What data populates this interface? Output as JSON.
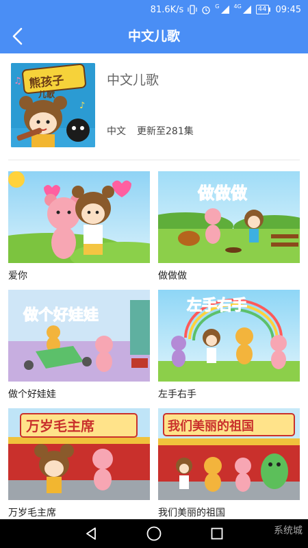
{
  "status_bar": {
    "speed": "81.6K/s",
    "network_label": "4G",
    "signal_label": "G",
    "battery": "44",
    "time": "09:45"
  },
  "header": {
    "title": "中文儿歌"
  },
  "album": {
    "name": "中文儿歌",
    "language": "中文",
    "episodes": "更新至281集",
    "cover_logo_text": "熊孩子儿歌"
  },
  "songs": [
    {
      "title": "爱你",
      "banner": ""
    },
    {
      "title": "做做做",
      "banner": "做做做"
    },
    {
      "title": "做个好娃娃",
      "banner": "做个好娃娃"
    },
    {
      "title": "左手右手",
      "banner": "左手右手"
    },
    {
      "title": "万岁毛主席",
      "banner": "万岁毛主席"
    },
    {
      "title": "我们美丽的祖国",
      "banner": "我们美丽的祖国"
    }
  ],
  "watermark": "系统城",
  "colors": {
    "primary": "#4a8ef5",
    "nav": "#000000"
  },
  "icons": {
    "back": "chevron-left-icon",
    "nav_back": "triangle-back-icon",
    "nav_home": "circle-home-icon",
    "nav_recents": "square-recents-icon"
  }
}
